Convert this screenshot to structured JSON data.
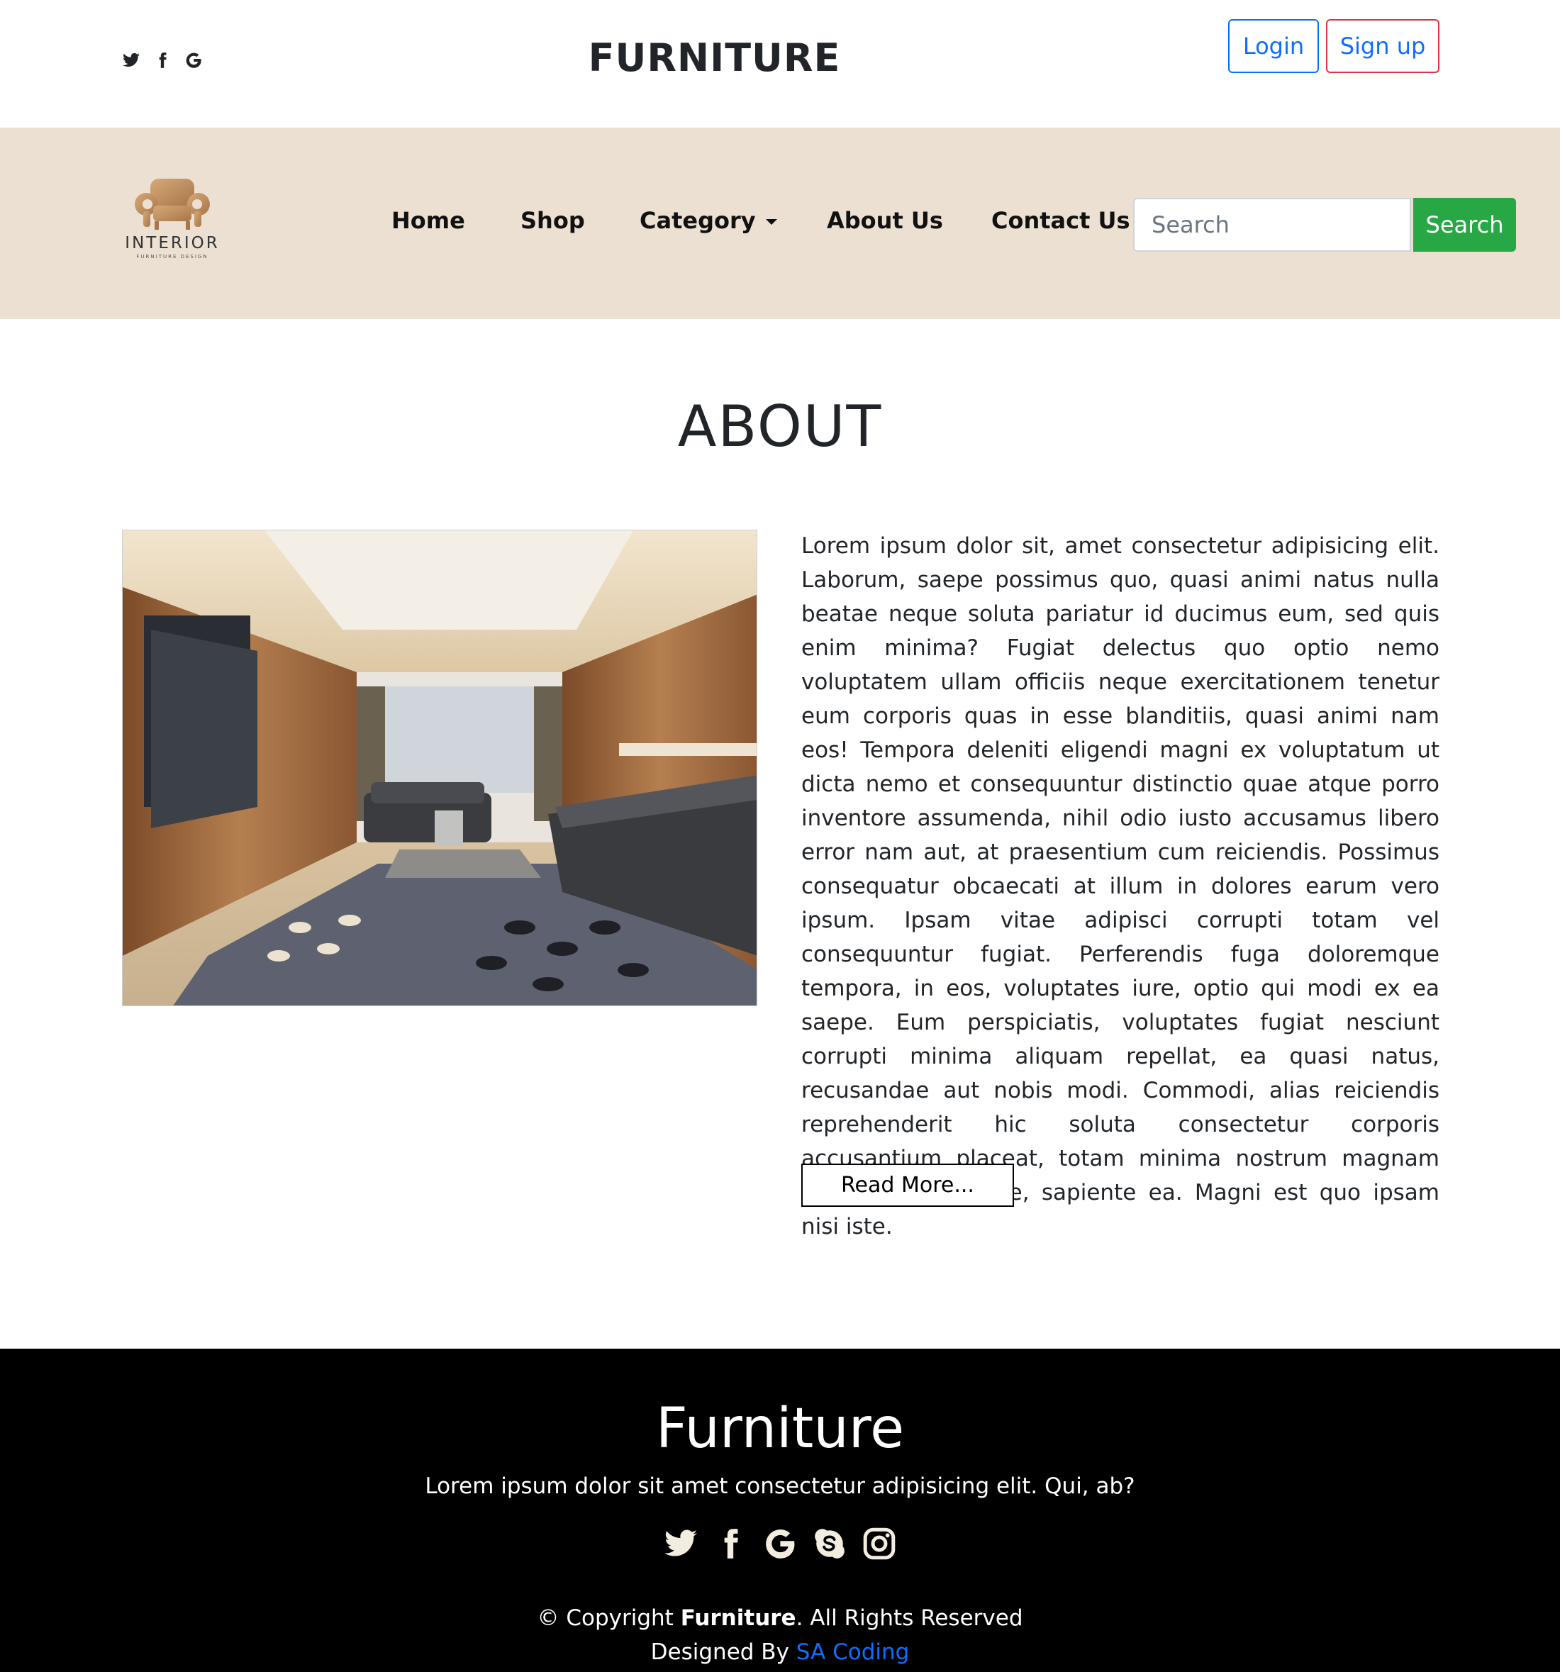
{
  "header": {
    "social_icons": [
      "twitter-icon",
      "facebook-icon",
      "google-icon"
    ],
    "brand_title": "FURNITURE",
    "login_label": "Login",
    "signup_label": "Sign up"
  },
  "nav": {
    "logo_word": "INTERIOR",
    "logo_sub": "FURNITURE DESIGN",
    "items": [
      {
        "label": "Home"
      },
      {
        "label": "Shop"
      },
      {
        "label": "Category"
      },
      {
        "label": "About Us"
      },
      {
        "label": "Contact Us"
      }
    ],
    "search_placeholder": "Search",
    "search_button": "Search",
    "background": "#ece0d3"
  },
  "about": {
    "title": "ABOUT",
    "paragraph": "Lorem ipsum dolor sit, amet consectetur adipisicing elit. Laborum, saepe possimus quo, quasi animi natus nulla beatae neque soluta pariatur id ducimus eum, sed quis enim minima? Fugiat delectus quo optio nemo voluptatem ullam officiis neque exercitationem tenetur eum corporis quas in esse blanditiis, quasi animi nam eos! Tempora deleniti eligendi magni ex voluptatum ut dicta nemo et consequuntur distinctio quae atque porro inventore assumenda, nihil odio iusto accusamus libero error nam aut, at praesentium cum reiciendis. Possimus consequatur obcaecati at illum in dolores earum vero ipsum. Ipsam vitae adipisci corrupti totam vel consequuntur fugiat. Perferendis fuga doloremque tempora, in eos, voluptates iure, optio qui modi ex ea saepe. Eum perspiciatis, voluptates fugiat nesciunt corrupti minima aliquam repellat, ea quasi natus, recusandae aut nobis modi. Commodi, alias reiciendis reprehenderit hic soluta consectetur corporis accusantium placeat, totam minima nostrum magnam dolorum aut dolore, sapiente ea. Magni est quo ipsam nisi iste.",
    "read_more": "Read More..."
  },
  "footer": {
    "title": "Furniture",
    "tagline": "Lorem ipsum dolor sit amet consectetur adipisicing elit. Qui, ab?",
    "social_icons": [
      "twitter-icon",
      "facebook-icon",
      "google-icon",
      "skype-icon",
      "instagram-icon"
    ],
    "copyright_prefix": "© Copyright ",
    "copyright_brand": "Furniture",
    "copyright_suffix": ". All Rights Reserved",
    "designed_prefix": "Designed By ",
    "designed_link": "SA Coding",
    "link_color": "#0d6efd"
  },
  "colors": {
    "success_button": "#28a745",
    "login_border": "#0d6efd",
    "signup_border": "#dc3545"
  }
}
